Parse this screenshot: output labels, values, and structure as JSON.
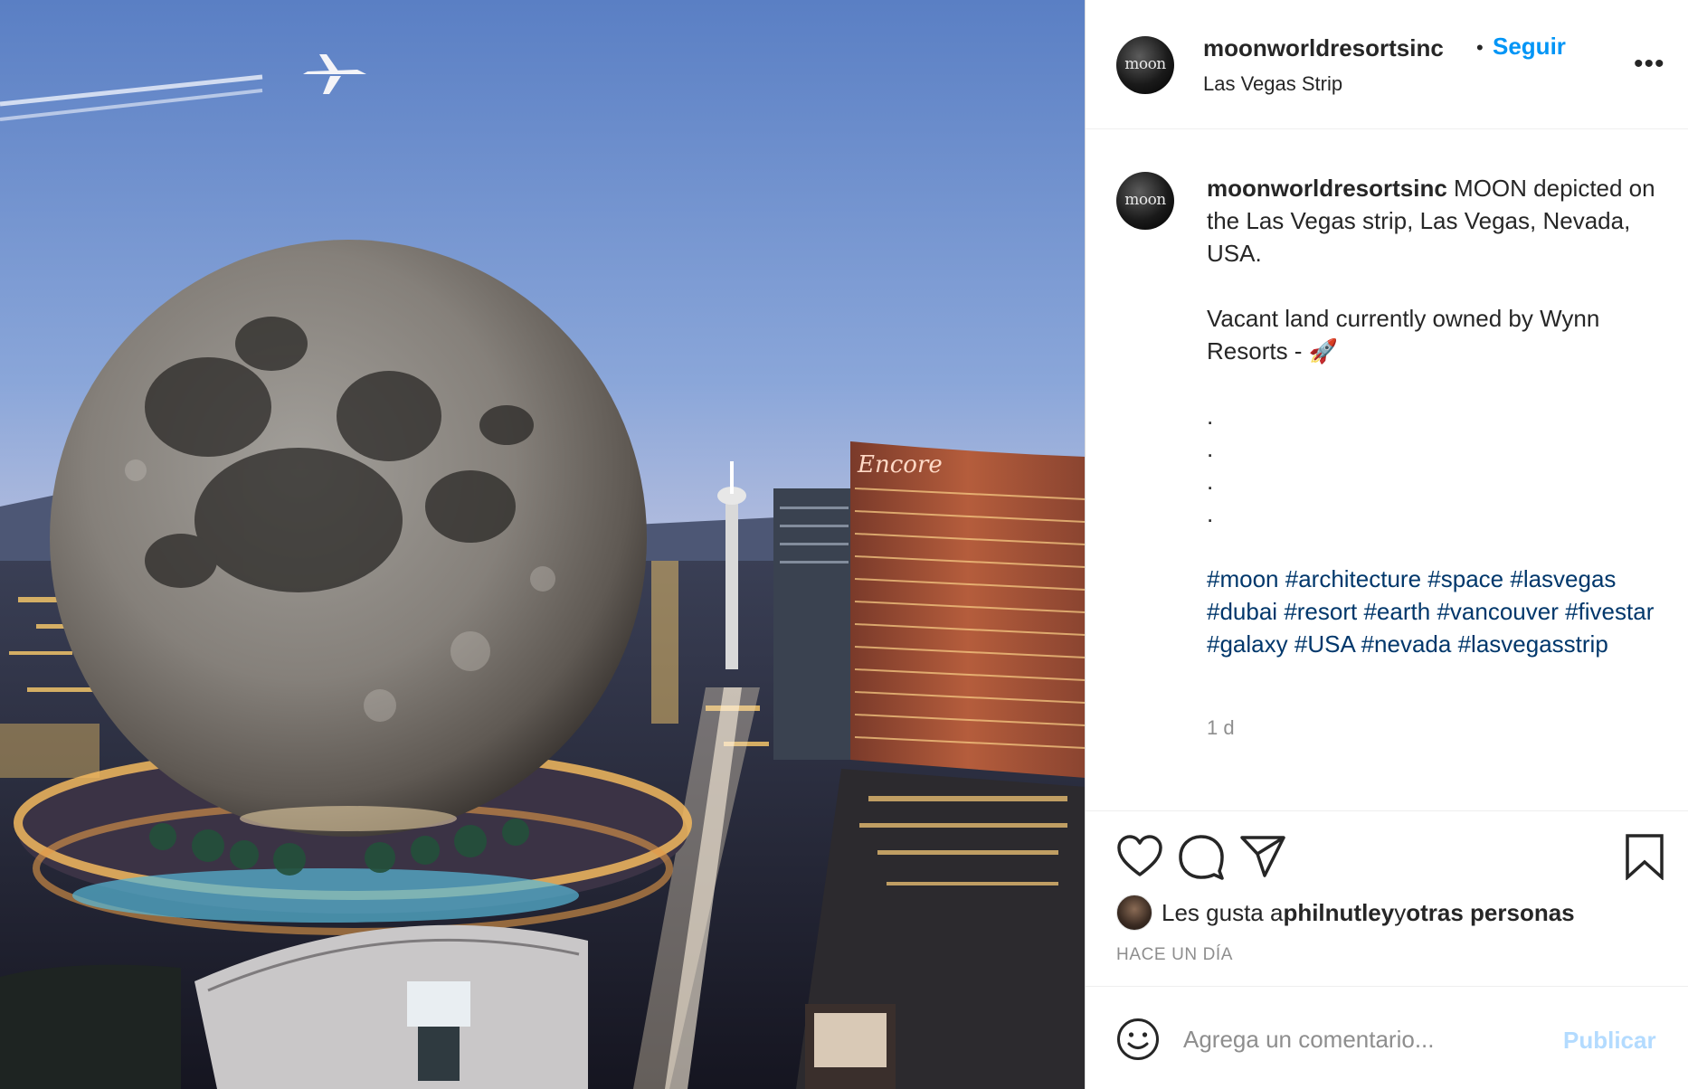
{
  "post": {
    "username": "moonworldresortsinc",
    "follow_label": "Seguir",
    "separator": "•",
    "location": "Las Vegas Strip",
    "more_label": "•••",
    "avatar_text": "moon",
    "photo_sign": "Encore"
  },
  "caption": {
    "username": "moonworldresortsinc",
    "line1": " MOON depicted on the Las Vegas strip, Las Vegas, Nevada, USA.",
    "line2": "Vacant land currently owned by Wynn Resorts - 🚀",
    "dots": [
      ".",
      ".",
      ".",
      "."
    ],
    "hashtags": [
      "#moon",
      "#architecture",
      "#space",
      "#lasvegas",
      "#dubai",
      "#resort",
      "#earth",
      "#vancouver",
      "#fivestar",
      "#galaxy",
      "#USA",
      "#nevada",
      "#lasvegasstrip"
    ],
    "time": "1 d"
  },
  "actions": {
    "like_icon": "heart-icon",
    "comment_icon": "comment-icon",
    "share_icon": "paper-plane-icon",
    "save_icon": "bookmark-icon"
  },
  "likes": {
    "prefix": "Les gusta a ",
    "user": "philnutley",
    "middle": " y ",
    "others": "otras personas"
  },
  "date": "HACE UN DÍA",
  "comment": {
    "placeholder": "Agrega un comentario...",
    "publish_label": "Publicar",
    "emoji_icon": "smiley-icon"
  },
  "colors": {
    "follow": "#0095f6",
    "hashtag": "#00376b",
    "muted": "#8e8e8e",
    "publish_disabled": "#b3dbff"
  }
}
